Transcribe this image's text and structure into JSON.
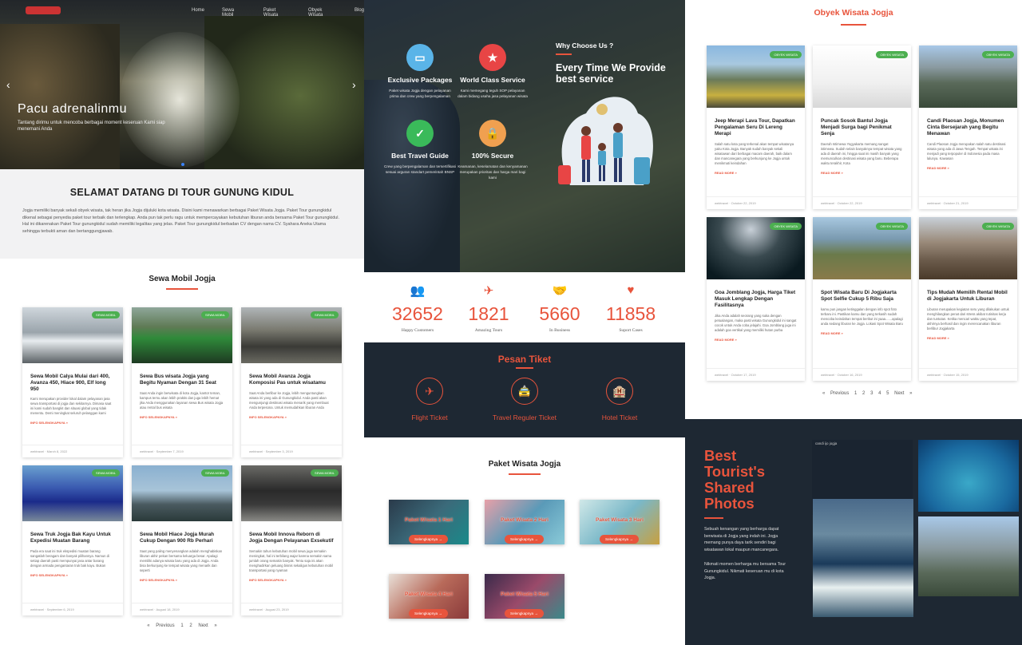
{
  "hero": {
    "nav": [
      "Home",
      "Sewa Mobil",
      "Paket Wisata",
      "Obyek Wisata",
      "Blog"
    ],
    "title": "Pacu adrenalinmu",
    "subtitle": "Tantang dirimu untuk mencoba berbagai moment keseruan Kami siap menemani Anda",
    "prev": "‹",
    "next": "›"
  },
  "welcome": {
    "title": "SELAMAT DATANG DI TOUR GUNUNG KIDUL",
    "body": "Jogja memiliki banyak sekali obyek wisata, tak heran jika Jogja dijuluki kota wisata. Disini kami menawarkan berbagai Paket Wisata Jogja. Paket Tour gunungkidul dikenal sebagai penyedia paket tour terbaik dan terlengkap. Anda pun tak perlu ragu untuk mempercayakan kebutuhan liburan anda bersama Paket Tour gunungkidul. Hal ini dikarenakan Paket Tour gunungkidul sudah memiliki legalitas yang jelas. Paket Tour gunungkidul berbadan CV dengan nama CV. Syahara Aneka Utama sehingga terbukti aman dan bertanggungjawab."
  },
  "sewa": {
    "title": "Sewa Mobil Jogja",
    "cards": [
      {
        "badge": "SEWA MOBIL",
        "title": "Sewa Mobil Calya Mulai dari 400, Avanza 450, Hiace 900, Elf long 950",
        "excerpt": "Kami merupakan provider lokal dalam pelayanan jasa sewa transportasi di jogja dan sekitarnya. Dimasa saat ini kami sudah bangkit dan situasi global yang tidak menentu. Demi meningkat seluruh pelanggan kami",
        "more": "INFO SELENGKAPNYA »",
        "meta": "webtravel  ·  March 8, 2022"
      },
      {
        "badge": "SEWA MOBIL",
        "title": "Sewa Bus wisata Jogja yang Begitu Nyaman Dengan 31 Seat",
        "excerpt": "Saat Anda ingin berwisata di kota Jogja, kantor teman, kampus ternu akan lebih praktis dan juga lebih hemat jika Anda menggunakan layanan sewa Bus wisata Jogja atau rental bus wisata",
        "more": "INFO SELENGKAPNYA »",
        "meta": "webtravel  ·  September 7, 2019"
      },
      {
        "badge": "SEWA MOBIL",
        "title": "Sewa Mobil Avanza Jogja Komposisi Pas untuk wisatamu",
        "excerpt": "Saat Anda berlibur ke Jogja, lebih menguntungkan wisata ini yang ada di Gunungkidul. Anda pasti akan mengunjungi destinasi wisata menarik yang membuat Anda terpesona. Untuk memudahkan liburan Anda",
        "more": "INFO SELENGKAPNYA »",
        "meta": "webtravel  ·  September 3, 2019"
      },
      {
        "badge": "SEWA MOBIL",
        "title": "Sewa Truk Jogja Bak Kayu Untuk Expedisi Muatan Barang",
        "excerpt": "Pada era saat ini truk ekspedisi muatan barang sangatlah beragam dan banyak pilihannya. Namun di setiap daerah pasti mempunyai jasa antar barang dengan armada pengantaran truk bak kayu. Bukan",
        "more": "INFO SELENGKAPNYA »",
        "meta": "webtravel  ·  September 6, 2019"
      },
      {
        "badge": "SEWA MOBIL",
        "title": "Sewa Mobil Hiace Jogja Murah Cukup Dengan 900 Rb Perhari",
        "excerpt": "Saat yang paling menyenangkan adalah menghabiskan liburan akhir pekan bersama keluarga besar. Apalagi memiliki adanya wisata baru yang ada di Jogja. Anda bisa berkunjung ke tempat wisata yang menarik dan seperti",
        "more": "INFO SELENGKAPNYA »",
        "meta": "webtravel  ·  August 18, 2019"
      },
      {
        "badge": "SEWA MOBIL",
        "title": "Sewa Mobil Innova Reborn di Jogja Dengan Pelayanan Exsekutif",
        "excerpt": "Semakin tahun kebutuhan mobil sewa juga semakin meningkat, hal ini terbilang wajar karena semakin sama jumlah orang semakin banyak. Tentu saja ini akan menghadirkan peluang bisnis sekaligus kebutuhan mobil transportasi yang nyaman",
        "more": "INFO SELENGKAPNYA »",
        "meta": "webtravel  ·  August 23, 2019"
      }
    ],
    "pager": [
      "« Previous",
      "1",
      "2",
      "Next »"
    ]
  },
  "why": {
    "heading": "Why Choose Us ?",
    "headline": "Every Time We Provide best service",
    "features": [
      {
        "icon": "▭",
        "title": "Exclusive Packages",
        "text": "Paket wisata Jogja dengan pelayanan prima dan crew yang berpengalaman",
        "color": "#5ab4e8"
      },
      {
        "icon": "★",
        "title": "World Class Service",
        "text": "Kami memegang teguh SOP pelayanan dalam bidang usaha jasa pelayanan wisata",
        "color": "#e84545"
      },
      {
        "icon": "✓",
        "title": "Best Travel Guide",
        "text": "Crew yang berpengalaman dan tersertifikasi sesuai arguran standart pemerintah BNSP",
        "color": "#3aba5a"
      },
      {
        "icon": "🔒",
        "title": "100% Secure",
        "text": "Keamanan, keselamatan dan kenyamanan merupakan prioritas dan harga mari bagi kami",
        "color": "#f0a050"
      }
    ]
  },
  "stats": [
    {
      "icon": "👥",
      "value": "32652",
      "label": "Happy Customers"
    },
    {
      "icon": "✈",
      "value": "1821",
      "label": "Amazing Tours"
    },
    {
      "icon": "🤝",
      "value": "5660",
      "label": "In Business"
    },
    {
      "icon": "♥",
      "value": "11858",
      "label": "Suport Cases"
    }
  ],
  "pesan": {
    "title": "Pesan Tiket",
    "tickets": [
      {
        "icon": "✈",
        "label": "Flight Ticket"
      },
      {
        "icon": "🚖",
        "label": "Travel Reguler Ticket"
      },
      {
        "icon": "🏨",
        "label": "Hotel Ticket"
      }
    ]
  },
  "paket": {
    "title": "Paket Wisata Jogja",
    "items": [
      {
        "title": "Paket Wisata 1 Hari",
        "button": "Selengkapnya →",
        "bg": "#3b5a6a"
      },
      {
        "title": "Paket Wisata 2 Hari",
        "button": "Selengkapnya →",
        "bg": "#5a8aa0"
      },
      {
        "title": "Paket Wisata 3 Hari",
        "button": "Selengkapnya →",
        "bg": "#7ab8c8"
      },
      {
        "title": "Paket Wisata 4 Hari",
        "button": "Selengkapnya →",
        "bg": "#a85a4a"
      },
      {
        "title": "Paket Wisata 5 Hari",
        "button": "Selengkapnya →",
        "bg": "#6a3a5a"
      }
    ]
  },
  "obyek": {
    "title": "Obyek Wisata Jogja",
    "cards": [
      {
        "badge": "OBYEK WISATA",
        "title": "Jeep Merapi Lava Tour, Dapatkan Pengalaman Seru Di Lereng Merapi",
        "excerpt": "Salah satu kota yang terkenal akan tempat wisatanya yaitu Kota Jogja. Banyak sudah banyak sekali wisatawan dari berbagai macam daerah, baik dalam dan mancanegara yang berkunjung ke Jogja untuk menikmati keindahan",
        "more": "READ MORE »",
        "meta": "webtravel  ·  October 22, 2019"
      },
      {
        "badge": "OBYEK WISATA",
        "title": "Puncak Sosok Bantul Jogja Menjadi Surga bagi Penikmat Senja",
        "excerpt": "Daerah Istimewa Yogyakarta memang sangat istimewa. Sudah selain banyaknya tempat wisata yang ada di daerah ini, hingga saat ini masih banyak yang memunculkan destinasi wisata yang baru. Beberapa waktu terakhir, Kota",
        "more": "READ MORE »",
        "meta": "webtravel  ·  October 22, 2019"
      },
      {
        "badge": "OBYEK WISATA",
        "title": "Candi Plaosan Jogja, Monumen Cinta Bersejarah yang Begitu Menawan",
        "excerpt": "Candi Plaosan Jogja merupakan salah satu destinasi wisata yang ada di Jawa Tengah. Tempat wisata ini menjadi yang terpopuler di Indonesia pada masa lalunya. Kawasan",
        "more": "READ MORE »",
        "meta": "webtravel  ·  October 21, 2019"
      },
      {
        "badge": "OBYEK WISATA",
        "title": "Goa Jomblang Jogja, Harga Tiket Masuk Lengkap Dengan Fasilitasnya",
        "excerpt": "Jika Anda adalah seorang yang suka dengan petualangan, maka pasti wisata Gunungkidul ini sangat cocok untuk Anda coba jelajahi. Goa Jomblang juga ini adalah goa vertikal yang memiliki hutan purba",
        "more": "READ MORE »",
        "meta": "webtravel  ·  October 17, 2019"
      },
      {
        "badge": "OBYEK WISATA",
        "title": "Spot Wisata Baru Di Jogjakarta Spot Selfie Cukup 5 Ribu Saja",
        "excerpt": "kamu pun jangan ketinggalan dengan info spot foto terbaru ini. Pastikan kamu dan yang terkasih sudah mencoba keindahan tempat berikut ini yaaa.......apalagi anda sedang liburan ke Jogja. Lokasi Spot Wisata Baru",
        "more": "READ MORE »",
        "meta": "webtravel  ·  October 16, 2019"
      },
      {
        "badge": "OBYEK WISATA",
        "title": "Tips Mudah Memilih Rental Mobil di Jogjakarta Untuk Liburan",
        "excerpt": "Liburan merupakan kegiatan seru yang dilakukan untuk menghilangkan penat dari stress akibat rutinitas kerja dan tuntutan. Ketika mencari waktu yang tepat, akhirnya berhasil dan ingin merencanakan liburan berlibur Jogjakarta",
        "more": "READ MORE »",
        "meta": "webtravel  ·  October 15, 2019"
      }
    ],
    "pager": [
      "« Previous",
      "1",
      "2",
      "3",
      "4",
      "5",
      "Next »"
    ]
  },
  "photos": {
    "title": "Best Tourist's Shared Photos",
    "p1": "Sebuah kenangan yang berharga dapat berwisata di Jogja yang indah ini. Jogja memang punya daya tarik sendiri bagi wisatawan lokal maupun mancanegara.",
    "p2": "Nikmati momen berharga mu bersama Tour Gunungkidul. Nikmati keseruan mu di kota Jogja.",
    "caption": "candi ijo jogja"
  }
}
